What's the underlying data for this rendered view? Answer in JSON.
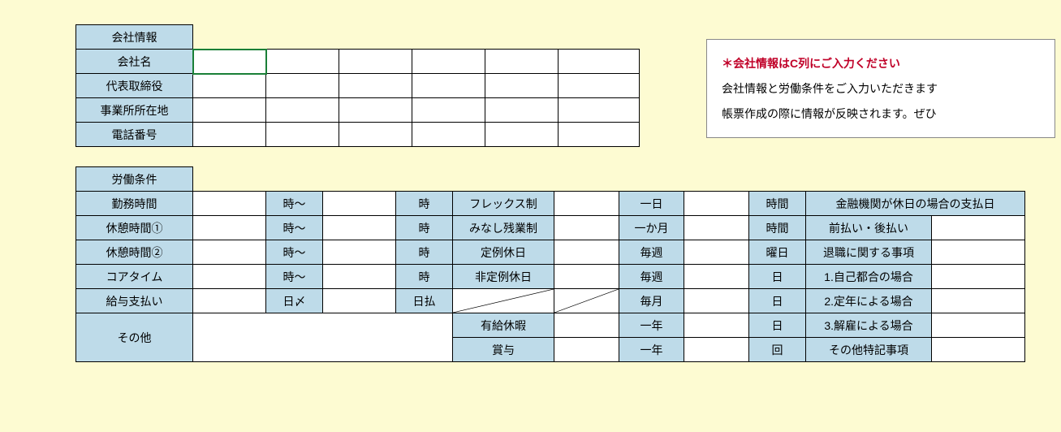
{
  "company": {
    "header": "会社情報",
    "fields": {
      "name": "会社名",
      "ceo": "代表取締役",
      "address": "事業所所在地",
      "tel": "電話番号"
    },
    "values": {
      "name": "",
      "ceo": "",
      "address": "",
      "tel": ""
    }
  },
  "work": {
    "header": "労働条件",
    "left_labels": {
      "hours": "勤務時間",
      "break1": "休憩時間①",
      "break2": "休憩時間②",
      "core": "コアタイム",
      "pay": "給与支払い",
      "other": "その他"
    },
    "jikara": "時～",
    "ji": "時",
    "nichishime": "日〆",
    "nichiharai": "日払",
    "mid": {
      "flex": "フレックス制",
      "minashi": "みなし残業制",
      "teirei": "定例休日",
      "hiteirei": "非定例休日",
      "yuukyuu": "有給休暇",
      "shouyo": "賞与"
    },
    "unit": {
      "day": "一日",
      "month": "一か月",
      "weekly": "毎週",
      "monthly": "毎月",
      "year": "一年"
    },
    "unit2": {
      "jikan": "時間",
      "youbi": "曜日",
      "nichi": "日",
      "kai": "回"
    },
    "right": {
      "r1": "金融機関が休日の場合の支払日",
      "r2": "前払い・後払い",
      "r3": "退職に関する事項",
      "r4": "1.自己都合の場合",
      "r5": "2.定年による場合",
      "r6": "3.解雇による場合",
      "r7": "その他特記事項"
    }
  },
  "note": {
    "line1": "＊会社情報はC列にご入力ください",
    "line2": "会社情報と労働条件をご入力いただきます",
    "line3": "帳票作成の際に情報が反映されます。ぜひ"
  }
}
